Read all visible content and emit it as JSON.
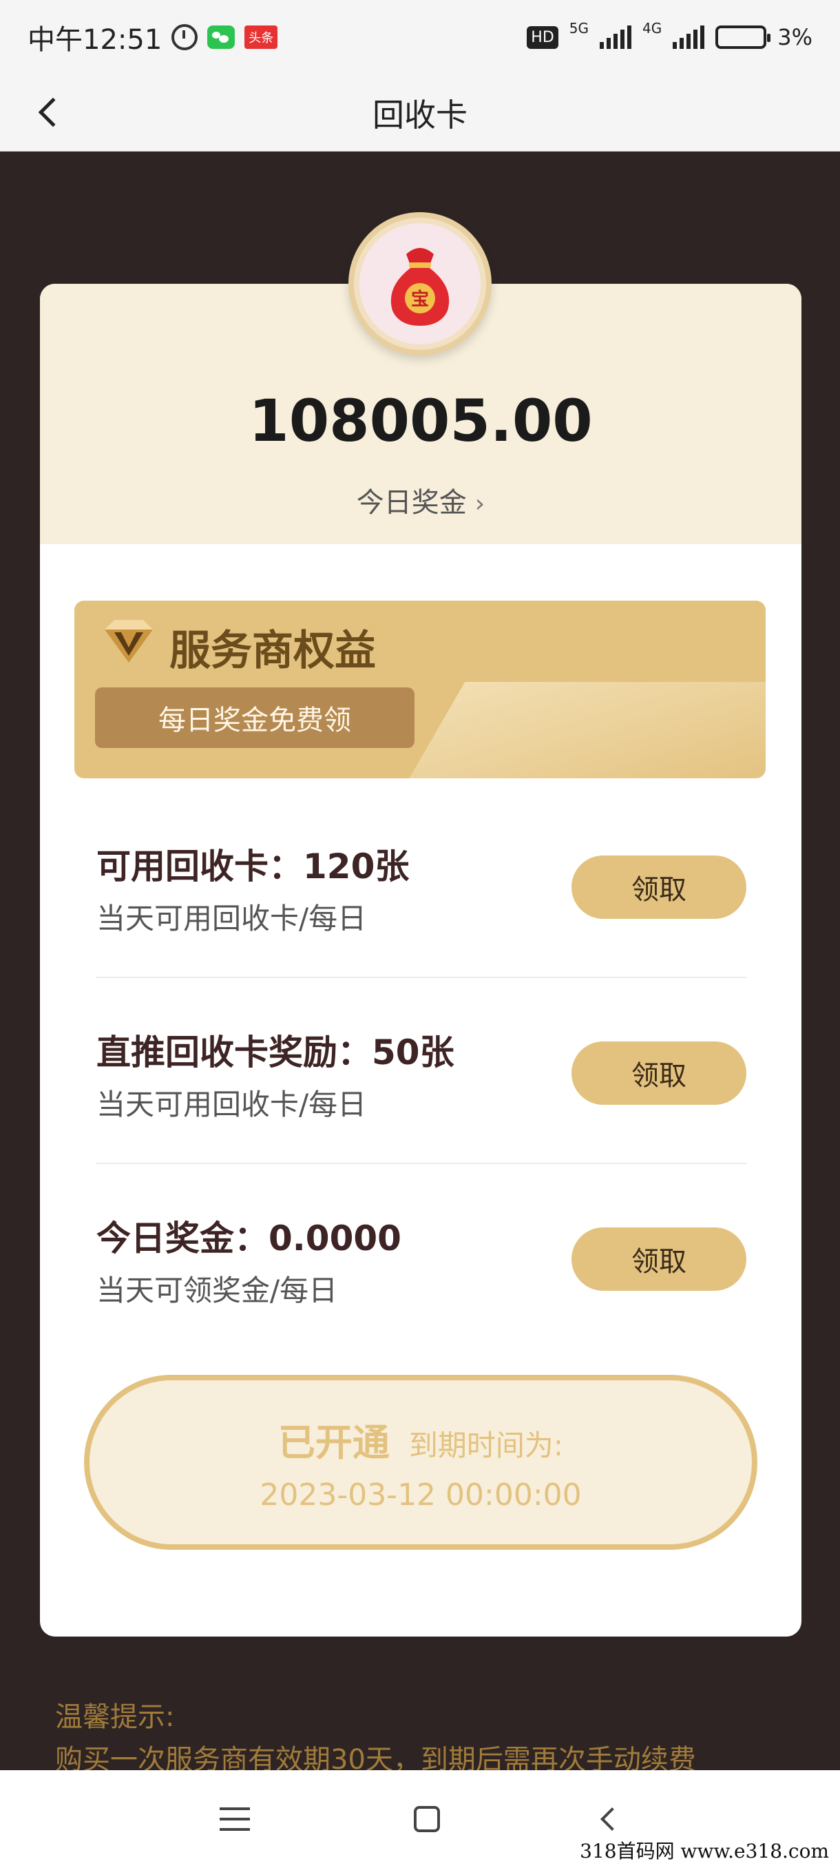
{
  "status_bar": {
    "time": "中午12:51",
    "toutiao": "头条",
    "hd": "HD",
    "net1": "5G",
    "net2": "4G",
    "battery": "3%"
  },
  "header": {
    "title": "回收卡"
  },
  "summary": {
    "amount": "108005.00",
    "link_label": "今日奖金",
    "link_chevron": "›"
  },
  "avatar": {
    "icon": "money-bag",
    "bag_char": "宝"
  },
  "privilege": {
    "title": "服务商权益",
    "tag": "每日奖金免费领",
    "icon": "diamond-v-icon"
  },
  "rows": [
    {
      "title": "可用回收卡：120张",
      "subtitle": "当天可用回收卡/每日",
      "button": "领取"
    },
    {
      "title": "直推回收卡奖励：50张",
      "subtitle": "当天可用回收卡/每日",
      "button": "领取"
    },
    {
      "title": "今日奖金：0.0000",
      "subtitle": "当天可领奖金/每日",
      "button": "领取"
    }
  ],
  "activation": {
    "status": "已开通",
    "expire_label": "到期时间为:",
    "expire_date": "2023-03-12 00:00:00"
  },
  "tips": {
    "title": "温馨提示:",
    "text": "购买一次服务商有效期30天，到期后需再次手动续费"
  },
  "watermark": "318首码网  www.e318.com",
  "colors": {
    "gold": "#e3c27f",
    "dark_bg": "#2e2424",
    "cream": "#f7eedb"
  }
}
